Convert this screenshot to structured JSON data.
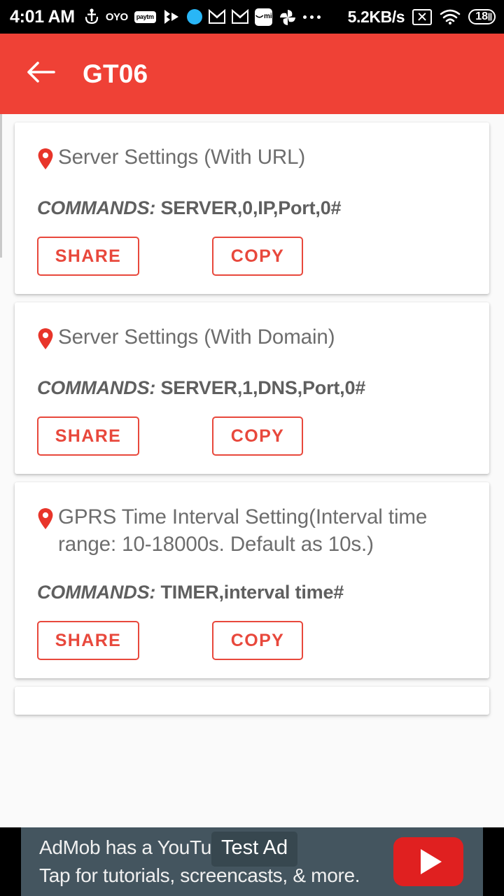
{
  "status_bar": {
    "time": "4:01 AM",
    "network_speed": "5.2KB/s",
    "battery_level": "18",
    "left_icons": [
      "anchor-icon",
      "oyo-icon",
      "paytm-icon",
      "play-share-icon",
      "blue-circle-icon",
      "gmail-icon",
      "gmail-icon",
      "mi-store-icon",
      "pinwheel-icon",
      "more-icons-icon"
    ],
    "right_icons": [
      "no-sim-icon",
      "wifi-icon",
      "battery-icon"
    ],
    "oyo_label": "OYO",
    "paytm_label": "paytm",
    "mi_label": "mi"
  },
  "app_bar": {
    "back_icon": "arrow-back-icon",
    "title": "GT06"
  },
  "commands_label": "COMMANDS:",
  "buttons": {
    "share": "SHARE",
    "copy": "COPY"
  },
  "cards": [
    {
      "title": "Server Settings (With URL)",
      "command": "SERVER,0,IP,Port,0#"
    },
    {
      "title": "Server Settings (With Domain)",
      "command": "SERVER,1,DNS,Port,0#"
    },
    {
      "title": "GPRS Time Interval Setting(Interval time range: 10-18000s. Default as 10s.)",
      "command": "TIMER,interval time#"
    }
  ],
  "ad": {
    "line1": "AdMob has a YouTube series!",
    "line2": "Tap for tutorials, screencasts, & more.",
    "badge": "Test Ad",
    "play_icon": "youtube-play-icon"
  },
  "colors": {
    "accent": "#ef4136",
    "button_outline": "#e8483c",
    "pin": "#e8352a",
    "ad_background": "#44555f",
    "title_text": "#6d6d6d"
  }
}
